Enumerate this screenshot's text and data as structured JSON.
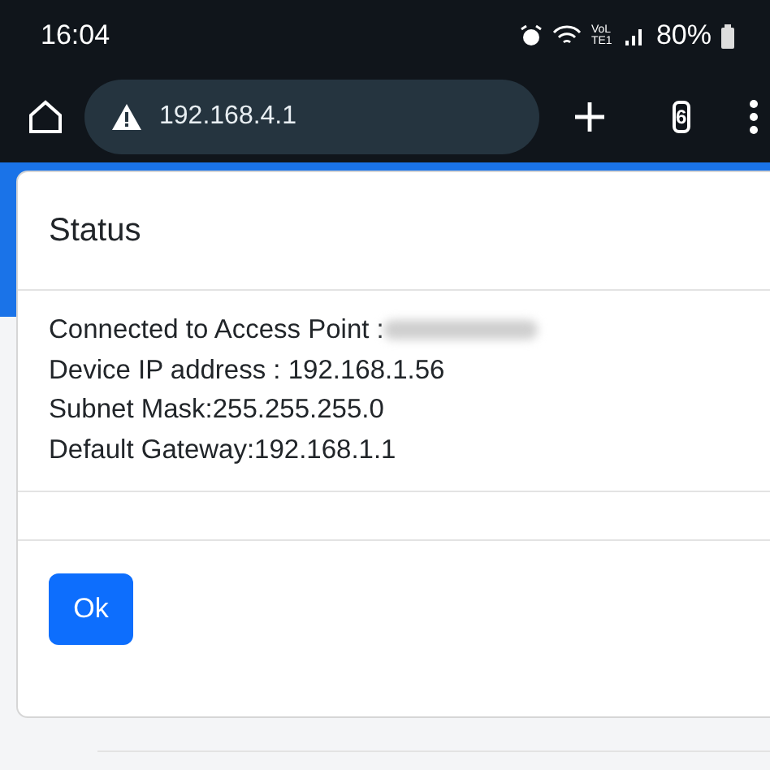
{
  "status_bar": {
    "time": "16:04",
    "battery": "80%",
    "network_label": "VoLTE1"
  },
  "browser": {
    "url": "192.168.4.1",
    "tab_count": "6"
  },
  "dialog": {
    "title": "Status",
    "lines": [
      {
        "label": "Connected to Access Point : ",
        "redacted": true
      },
      {
        "label": "Device IP address : 192.168.1.56",
        "redacted": false
      },
      {
        "label": "Subnet Mask:255.255.255.0",
        "redacted": false
      },
      {
        "label": "Default Gateway:192.168.1.1",
        "redacted": false
      }
    ],
    "button": "Ok"
  }
}
